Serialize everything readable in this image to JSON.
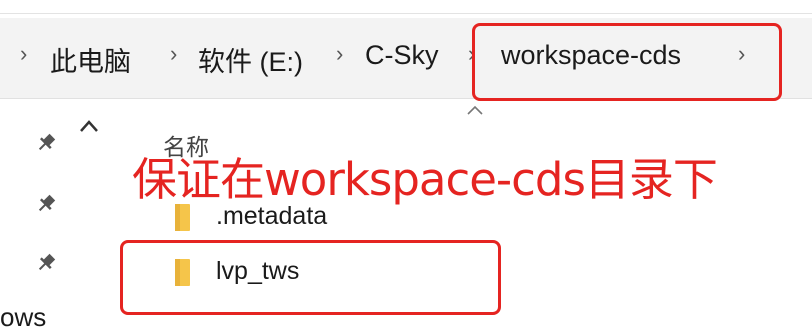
{
  "breadcrumb": {
    "items": [
      {
        "label": "此电脑"
      },
      {
        "label": "软件 (E:)"
      },
      {
        "label": "C-Sky"
      },
      {
        "label": "workspace-cds"
      }
    ]
  },
  "nav_pane": {
    "pins": [
      "pin-icon",
      "pin-icon",
      "pin-icon"
    ],
    "partial_label": "ows"
  },
  "file_list": {
    "column_header": "名称",
    "items": [
      {
        "name": ".metadata",
        "icon": "folder-icon"
      },
      {
        "name": "lvp_tws",
        "icon": "folder-icon"
      }
    ]
  },
  "annotation": {
    "text": "保证在workspace-cds目录下",
    "color": "#e52421"
  },
  "colors": {
    "folder": "#f5c54a",
    "highlight": "#e52421"
  }
}
